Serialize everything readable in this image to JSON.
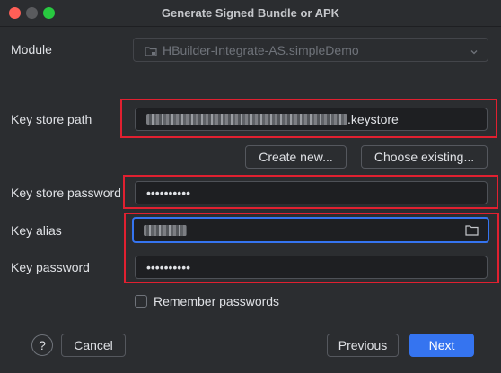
{
  "window": {
    "title": "Generate Signed Bundle or APK",
    "controls": [
      "close",
      "minimize",
      "maximize"
    ]
  },
  "module": {
    "label": "Module",
    "value": "HBuilder-Integrate-AS.simpleDemo",
    "icon": "module-folder-icon"
  },
  "keystore_path": {
    "label": "Key store path",
    "suffix": ".keystore"
  },
  "buttons": {
    "create_new": "Create new...",
    "choose_existing": "Choose existing...",
    "cancel": "Cancel",
    "previous": "Previous",
    "next": "Next",
    "help": "?"
  },
  "keystore_password": {
    "label": "Key store password",
    "value": "••••••••••"
  },
  "key_alias": {
    "label": "Key alias",
    "icon": "folder-icon"
  },
  "key_password": {
    "label": "Key password",
    "value": "••••••••••"
  },
  "remember": {
    "label": "Remember passwords",
    "checked": false
  },
  "colors": {
    "accent": "#3574f0",
    "highlight_box": "#e02030",
    "background": "#2b2d30"
  }
}
